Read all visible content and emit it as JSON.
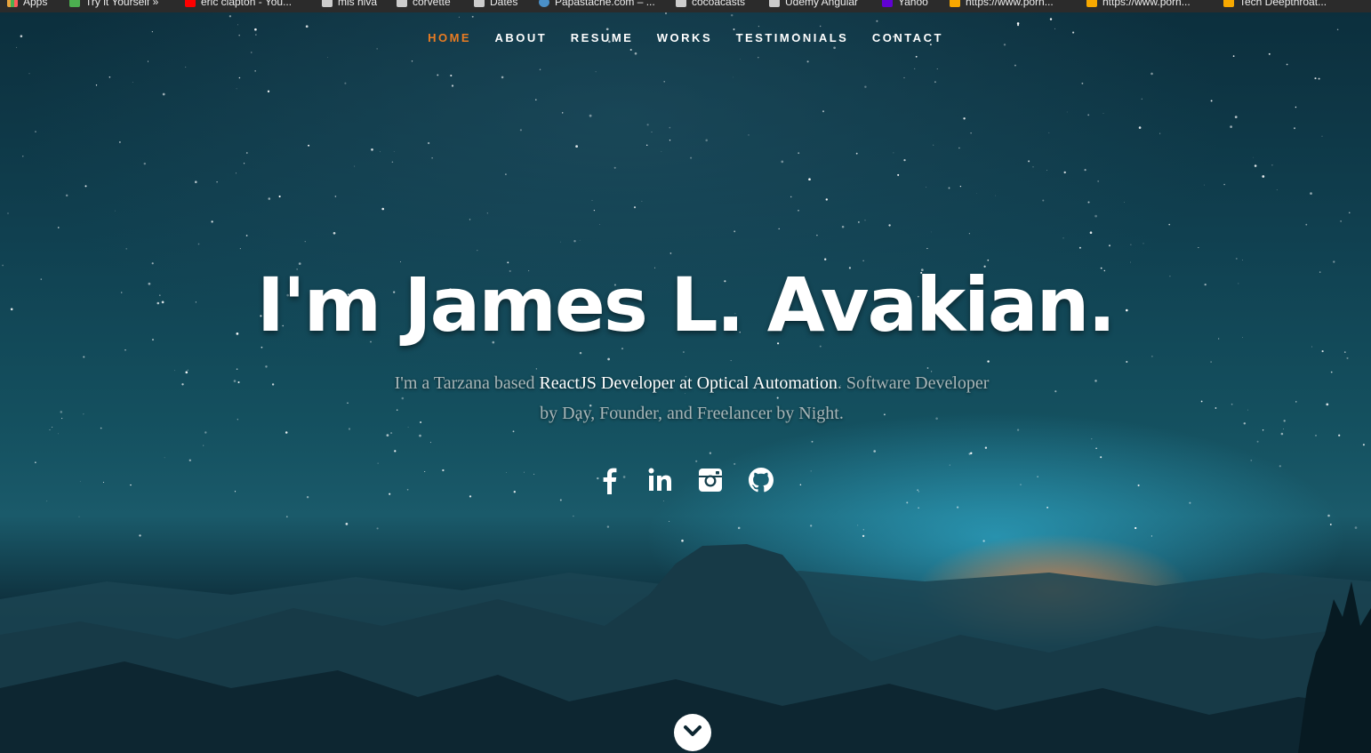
{
  "bookmarks": [
    {
      "label": "Apps",
      "icon": "apps-grid-icon",
      "color": "#e8a33d"
    },
    {
      "label": "Try it Yourself »",
      "icon": "w3schools-icon",
      "color": "#4caf50"
    },
    {
      "label": "eric clapton - You...",
      "icon": "youtube-icon",
      "color": "#ff0000"
    },
    {
      "label": "mis hiva",
      "icon": "folder-icon",
      "color": "#cccccc"
    },
    {
      "label": "corvette",
      "icon": "folder-icon",
      "color": "#cccccc"
    },
    {
      "label": "Dates",
      "icon": "folder-icon",
      "color": "#cccccc"
    },
    {
      "label": "Papastache.com – ...",
      "icon": "wordpress-icon",
      "color": "#4a90c8"
    },
    {
      "label": "cocoacasts",
      "icon": "folder-icon",
      "color": "#cccccc"
    },
    {
      "label": "Udemy Angular",
      "icon": "folder-icon",
      "color": "#cccccc"
    },
    {
      "label": "Yahoo",
      "icon": "yahoo-icon",
      "color": "#6001d2"
    },
    {
      "label": "https://www.porn...",
      "icon": "site-icon",
      "color": "#f7a800"
    },
    {
      "label": "https://www.porn...",
      "icon": "site-icon",
      "color": "#f7a800"
    },
    {
      "label": "Tech Deepthroat...",
      "icon": "site-icon",
      "color": "#f7a800"
    }
  ],
  "nav": {
    "items": [
      "HOME",
      "ABOUT",
      "RESUME",
      "WORKS",
      "TESTIMONIALS",
      "CONTACT"
    ],
    "active": "HOME",
    "active_color": "#e97c23"
  },
  "hero": {
    "title": "I'm James L. Avakian.",
    "subtitle_prefix": "I'm a Tarzana based ",
    "subtitle_highlight": "ReactJS Developer at Optical Automation",
    "subtitle_suffix": ". Software Developer by Day, Founder, and Freelancer by Night."
  },
  "social": [
    "facebook-icon",
    "linkedin-icon",
    "instagram-icon",
    "github-icon"
  ],
  "scroll": {
    "icon": "chevron-down-icon"
  }
}
